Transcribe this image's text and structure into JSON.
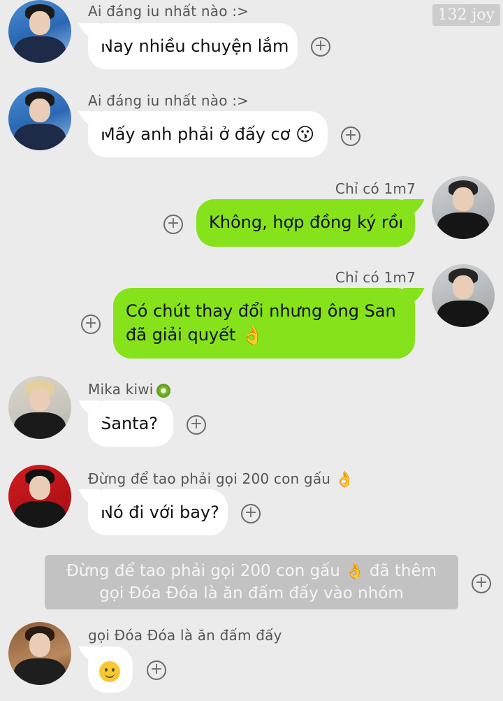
{
  "watermark": "132 joy",
  "messages": [
    {
      "sender": "Ai đáng iu nhất nào :>",
      "text": "Nay nhiều chuyện lắm"
    },
    {
      "sender": "Ai đáng iu nhất nào :>",
      "text": "Mấy anh phải ở đấy cơ",
      "emoji": "😗"
    },
    {
      "sender": "Chỉ có 1m7",
      "text": "Không, hợp đồng ký rồi"
    },
    {
      "sender": "Chỉ có 1m7",
      "line1": "Có chút thay đổi nhưng ông San",
      "line2": "đã giải quyết",
      "emoji": "👌"
    },
    {
      "sender": "Mika kiwi",
      "text": "Santa?"
    },
    {
      "sender": "Đừng để tao phải gọi 200 con gấu",
      "sender_emoji": "👌",
      "text": "Nó đi với bay?"
    },
    {
      "sender": "gọi Đóa Đóa là ăn đấm đấy",
      "text": ""
    }
  ],
  "system_notice": {
    "line1_a": "Đừng để tao phải gọi 200 con gấu",
    "line1_emoji": "👌",
    "line1_b": "đã thêm",
    "line2": "gọi Đóa Đóa là ăn đấm đấy vào nhóm"
  },
  "plus_glyph": "+"
}
